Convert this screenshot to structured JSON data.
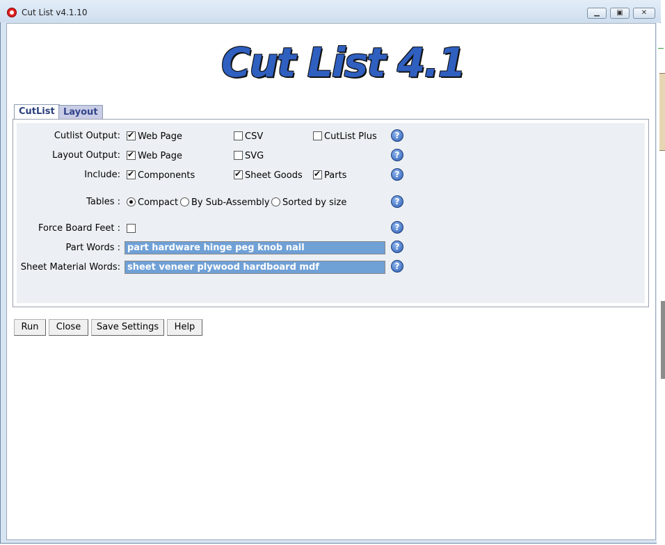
{
  "window": {
    "title": "Cut List v4.1.10",
    "min_glyph": "▁",
    "max_glyph": "▣",
    "close_glyph": "✕"
  },
  "logo": {
    "text": "Cut List 4.1"
  },
  "tabs": [
    {
      "label": "CutList",
      "active": true
    },
    {
      "label": "Layout",
      "active": false
    }
  ],
  "form": {
    "cutlist_output": {
      "label": "Cutlist Output:",
      "options": [
        {
          "label": "Web Page",
          "checked": true
        },
        {
          "label": "CSV",
          "checked": false
        },
        {
          "label": "CutList Plus",
          "checked": false
        }
      ]
    },
    "layout_output": {
      "label": "Layout Output:",
      "options": [
        {
          "label": "Web Page",
          "checked": true
        },
        {
          "label": "SVG",
          "checked": false
        }
      ]
    },
    "include": {
      "label": "Include:",
      "options": [
        {
          "label": "Components",
          "checked": true
        },
        {
          "label": "Sheet Goods",
          "checked": true
        },
        {
          "label": "Parts",
          "checked": true
        }
      ]
    },
    "tables": {
      "label": "Tables :",
      "options": [
        {
          "label": "Compact",
          "selected": true
        },
        {
          "label": "By Sub-Assembly",
          "selected": false
        },
        {
          "label": "Sorted by size",
          "selected": false
        }
      ]
    },
    "force_board_feet": {
      "label": "Force Board Feet :",
      "checked": false
    },
    "part_words": {
      "label": "Part Words :",
      "value": "part hardware hinge peg knob nail"
    },
    "sheet_words": {
      "label": "Sheet Material Words:",
      "value": "sheet veneer plywood hardboard mdf"
    },
    "help_glyph": "?"
  },
  "buttons": {
    "run": "Run",
    "close": "Close",
    "save": "Save Settings",
    "help": "Help"
  }
}
